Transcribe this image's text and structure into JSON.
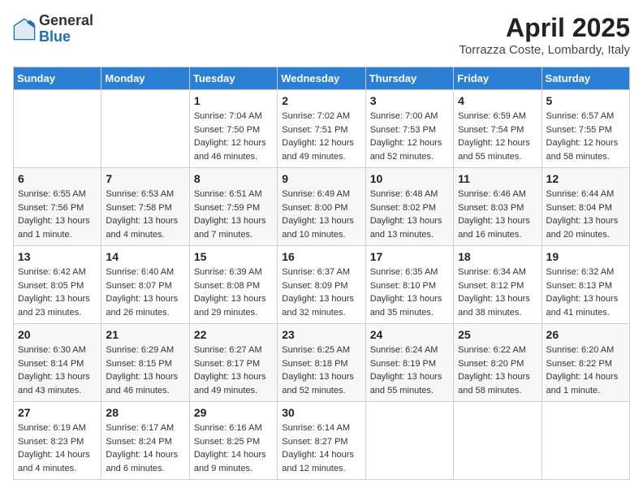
{
  "header": {
    "logo_general": "General",
    "logo_blue": "Blue",
    "month_title": "April 2025",
    "location": "Torrazza Coste, Lombardy, Italy"
  },
  "days_of_week": [
    "Sunday",
    "Monday",
    "Tuesday",
    "Wednesday",
    "Thursday",
    "Friday",
    "Saturday"
  ],
  "weeks": [
    [
      {
        "day": "",
        "info": ""
      },
      {
        "day": "",
        "info": ""
      },
      {
        "day": "1",
        "info": "Sunrise: 7:04 AM\nSunset: 7:50 PM\nDaylight: 12 hours and 46 minutes."
      },
      {
        "day": "2",
        "info": "Sunrise: 7:02 AM\nSunset: 7:51 PM\nDaylight: 12 hours and 49 minutes."
      },
      {
        "day": "3",
        "info": "Sunrise: 7:00 AM\nSunset: 7:53 PM\nDaylight: 12 hours and 52 minutes."
      },
      {
        "day": "4",
        "info": "Sunrise: 6:59 AM\nSunset: 7:54 PM\nDaylight: 12 hours and 55 minutes."
      },
      {
        "day": "5",
        "info": "Sunrise: 6:57 AM\nSunset: 7:55 PM\nDaylight: 12 hours and 58 minutes."
      }
    ],
    [
      {
        "day": "6",
        "info": "Sunrise: 6:55 AM\nSunset: 7:56 PM\nDaylight: 13 hours and 1 minute."
      },
      {
        "day": "7",
        "info": "Sunrise: 6:53 AM\nSunset: 7:58 PM\nDaylight: 13 hours and 4 minutes."
      },
      {
        "day": "8",
        "info": "Sunrise: 6:51 AM\nSunset: 7:59 PM\nDaylight: 13 hours and 7 minutes."
      },
      {
        "day": "9",
        "info": "Sunrise: 6:49 AM\nSunset: 8:00 PM\nDaylight: 13 hours and 10 minutes."
      },
      {
        "day": "10",
        "info": "Sunrise: 6:48 AM\nSunset: 8:02 PM\nDaylight: 13 hours and 13 minutes."
      },
      {
        "day": "11",
        "info": "Sunrise: 6:46 AM\nSunset: 8:03 PM\nDaylight: 13 hours and 16 minutes."
      },
      {
        "day": "12",
        "info": "Sunrise: 6:44 AM\nSunset: 8:04 PM\nDaylight: 13 hours and 20 minutes."
      }
    ],
    [
      {
        "day": "13",
        "info": "Sunrise: 6:42 AM\nSunset: 8:05 PM\nDaylight: 13 hours and 23 minutes."
      },
      {
        "day": "14",
        "info": "Sunrise: 6:40 AM\nSunset: 8:07 PM\nDaylight: 13 hours and 26 minutes."
      },
      {
        "day": "15",
        "info": "Sunrise: 6:39 AM\nSunset: 8:08 PM\nDaylight: 13 hours and 29 minutes."
      },
      {
        "day": "16",
        "info": "Sunrise: 6:37 AM\nSunset: 8:09 PM\nDaylight: 13 hours and 32 minutes."
      },
      {
        "day": "17",
        "info": "Sunrise: 6:35 AM\nSunset: 8:10 PM\nDaylight: 13 hours and 35 minutes."
      },
      {
        "day": "18",
        "info": "Sunrise: 6:34 AM\nSunset: 8:12 PM\nDaylight: 13 hours and 38 minutes."
      },
      {
        "day": "19",
        "info": "Sunrise: 6:32 AM\nSunset: 8:13 PM\nDaylight: 13 hours and 41 minutes."
      }
    ],
    [
      {
        "day": "20",
        "info": "Sunrise: 6:30 AM\nSunset: 8:14 PM\nDaylight: 13 hours and 43 minutes."
      },
      {
        "day": "21",
        "info": "Sunrise: 6:29 AM\nSunset: 8:15 PM\nDaylight: 13 hours and 46 minutes."
      },
      {
        "day": "22",
        "info": "Sunrise: 6:27 AM\nSunset: 8:17 PM\nDaylight: 13 hours and 49 minutes."
      },
      {
        "day": "23",
        "info": "Sunrise: 6:25 AM\nSunset: 8:18 PM\nDaylight: 13 hours and 52 minutes."
      },
      {
        "day": "24",
        "info": "Sunrise: 6:24 AM\nSunset: 8:19 PM\nDaylight: 13 hours and 55 minutes."
      },
      {
        "day": "25",
        "info": "Sunrise: 6:22 AM\nSunset: 8:20 PM\nDaylight: 13 hours and 58 minutes."
      },
      {
        "day": "26",
        "info": "Sunrise: 6:20 AM\nSunset: 8:22 PM\nDaylight: 14 hours and 1 minute."
      }
    ],
    [
      {
        "day": "27",
        "info": "Sunrise: 6:19 AM\nSunset: 8:23 PM\nDaylight: 14 hours and 4 minutes."
      },
      {
        "day": "28",
        "info": "Sunrise: 6:17 AM\nSunset: 8:24 PM\nDaylight: 14 hours and 6 minutes."
      },
      {
        "day": "29",
        "info": "Sunrise: 6:16 AM\nSunset: 8:25 PM\nDaylight: 14 hours and 9 minutes."
      },
      {
        "day": "30",
        "info": "Sunrise: 6:14 AM\nSunset: 8:27 PM\nDaylight: 14 hours and 12 minutes."
      },
      {
        "day": "",
        "info": ""
      },
      {
        "day": "",
        "info": ""
      },
      {
        "day": "",
        "info": ""
      }
    ]
  ]
}
